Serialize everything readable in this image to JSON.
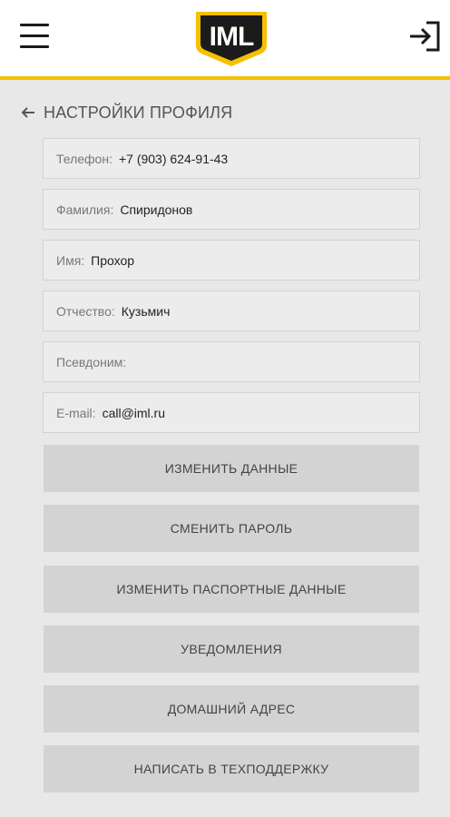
{
  "header": {
    "logo_text": "IML",
    "menu_icon": "hamburger-menu-icon",
    "login_icon": "login-arrow-icon",
    "accent_color": "#f5c000",
    "logo_color": "#1b1b1b"
  },
  "page": {
    "back_icon": "arrow-left-icon",
    "title": "НАСТРОЙКИ ПРОФИЛЯ"
  },
  "fields": [
    {
      "label": "Телефон:",
      "value": "+7 (903) 624-91-43"
    },
    {
      "label": "Фамилия:",
      "value": "Спиридонов"
    },
    {
      "label": "Имя:",
      "value": "Прохор"
    },
    {
      "label": "Отчество:",
      "value": "Кузьмич"
    },
    {
      "label": "Псевдоним:",
      "value": ""
    },
    {
      "label": "E-mail:",
      "value": "call@iml.ru"
    }
  ],
  "buttons": [
    {
      "label": "ИЗМЕНИТЬ ДАННЫЕ"
    },
    {
      "label": "СМЕНИТЬ ПАРОЛЬ"
    },
    {
      "label": "ИЗМЕНИТЬ ПАСПОРТНЫЕ ДАННЫЕ"
    },
    {
      "label": "УВЕДОМЛЕНИЯ"
    },
    {
      "label": "ДОМАШНИЙ АДРЕС"
    },
    {
      "label": "НАПИСАТЬ В ТЕХПОДДЕРЖКУ"
    }
  ]
}
